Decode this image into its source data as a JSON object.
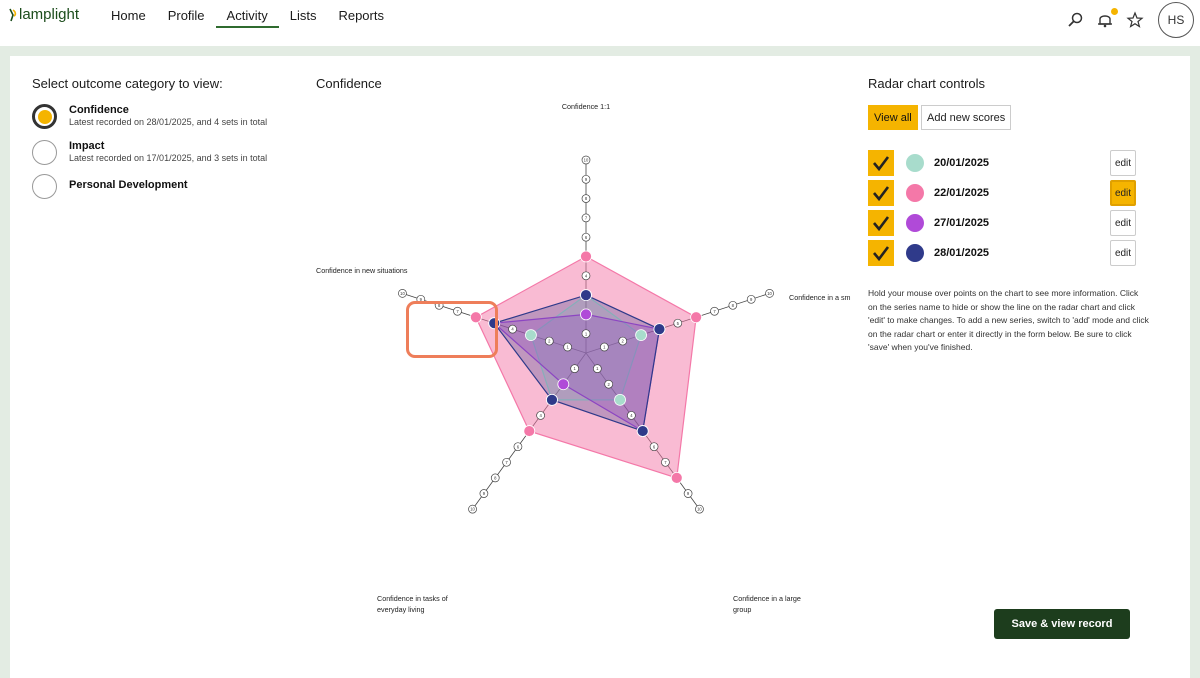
{
  "app": {
    "logo_text": "lamplight"
  },
  "nav": {
    "items": [
      {
        "label": "Home"
      },
      {
        "label": "Profile"
      },
      {
        "label": "Activity"
      },
      {
        "label": "Lists"
      },
      {
        "label": "Reports"
      }
    ],
    "active": "Activity"
  },
  "user": {
    "initials": "HS"
  },
  "left": {
    "title": "Select outcome category to view:",
    "categories": [
      {
        "name": "Confidence",
        "sub": "Latest recorded on 28/01/2025, and 4 sets in total",
        "selected": true
      },
      {
        "name": "Impact",
        "sub": "Latest recorded on 17/01/2025, and 3 sets in total",
        "selected": false
      },
      {
        "name": "Personal Development",
        "sub": "",
        "selected": false
      }
    ]
  },
  "chart": {
    "title": "Confidence",
    "axis_labels": [
      [
        "Confidence 1:1"
      ],
      [
        "Confidence in a sm"
      ],
      [
        "Confidence in a large",
        "group"
      ],
      [
        "Confidence in tasks of",
        "everyday living"
      ],
      [
        "Confidence in new situations"
      ]
    ]
  },
  "chart_data": {
    "type": "radar",
    "axes": [
      "Confidence 1:1",
      "Confidence in a sm",
      "Confidence in a large group",
      "Confidence in tasks of everyday living",
      "Confidence in new situations"
    ],
    "scale": [
      0,
      10
    ],
    "series": [
      {
        "name": "20/01/2025",
        "color": "#a8dccc",
        "values": [
          3,
          3,
          3,
          3,
          3
        ],
        "visible": true
      },
      {
        "name": "22/01/2025",
        "color": "#f478a8",
        "values": [
          5,
          6,
          8,
          5,
          6
        ],
        "visible": true
      },
      {
        "name": "27/01/2025",
        "color": "#b04ad8",
        "values": [
          2,
          4,
          5,
          2,
          5
        ],
        "visible": true
      },
      {
        "name": "28/01/2025",
        "color": "#2f3a8a",
        "values": [
          3,
          4,
          5,
          3,
          5
        ],
        "visible": true
      }
    ]
  },
  "controls": {
    "title": "Radar chart controls",
    "view_all_label": "View all",
    "add_scores_label": "Add new scores",
    "edit_label": "edit",
    "help_text": "Hold your mouse over points on the chart to see more information. Click on the series name to hide or show the line on the radar chart and click 'edit' to make changes. To add a new series, switch to 'add' mode and click on the radar chart or enter it directly in the form below. Be sure to click 'save' when you've finished.",
    "save_label": "Save & view record",
    "active_edit_index": 1
  }
}
